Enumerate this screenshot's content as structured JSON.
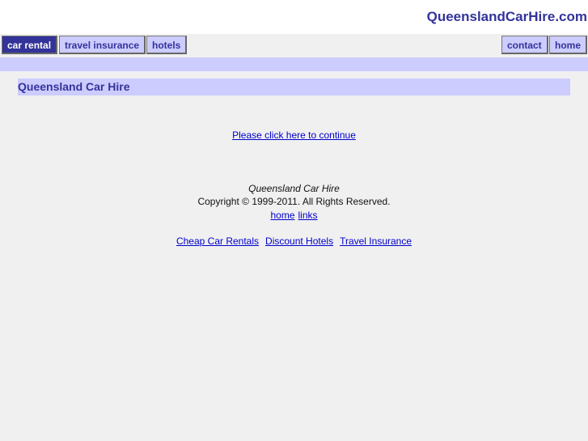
{
  "header": {
    "site_title": "QueenslandCarHire.com"
  },
  "nav": {
    "left_tabs": [
      {
        "label": "car rental",
        "active": true
      },
      {
        "label": "travel insurance",
        "active": false
      },
      {
        "label": "hotels",
        "active": false
      }
    ],
    "right_tabs": [
      {
        "label": "contact"
      },
      {
        "label": "home"
      }
    ]
  },
  "main": {
    "heading": "Queensland Car Hire",
    "continue_link": "Please click here to continue"
  },
  "footer": {
    "name": "Queensland Car Hire",
    "copyright": "Copyright © 1999-2011. All Rights Reserved.",
    "links": [
      "home",
      "links"
    ],
    "partner_links": [
      "Cheap Car Rentals",
      "Discount Hotels",
      "Travel Insurance"
    ]
  },
  "colors": {
    "brand": "#33339a",
    "tab_bg": "#ccccff",
    "page_bg": "#f0f0f0",
    "link": "#0000cc"
  }
}
